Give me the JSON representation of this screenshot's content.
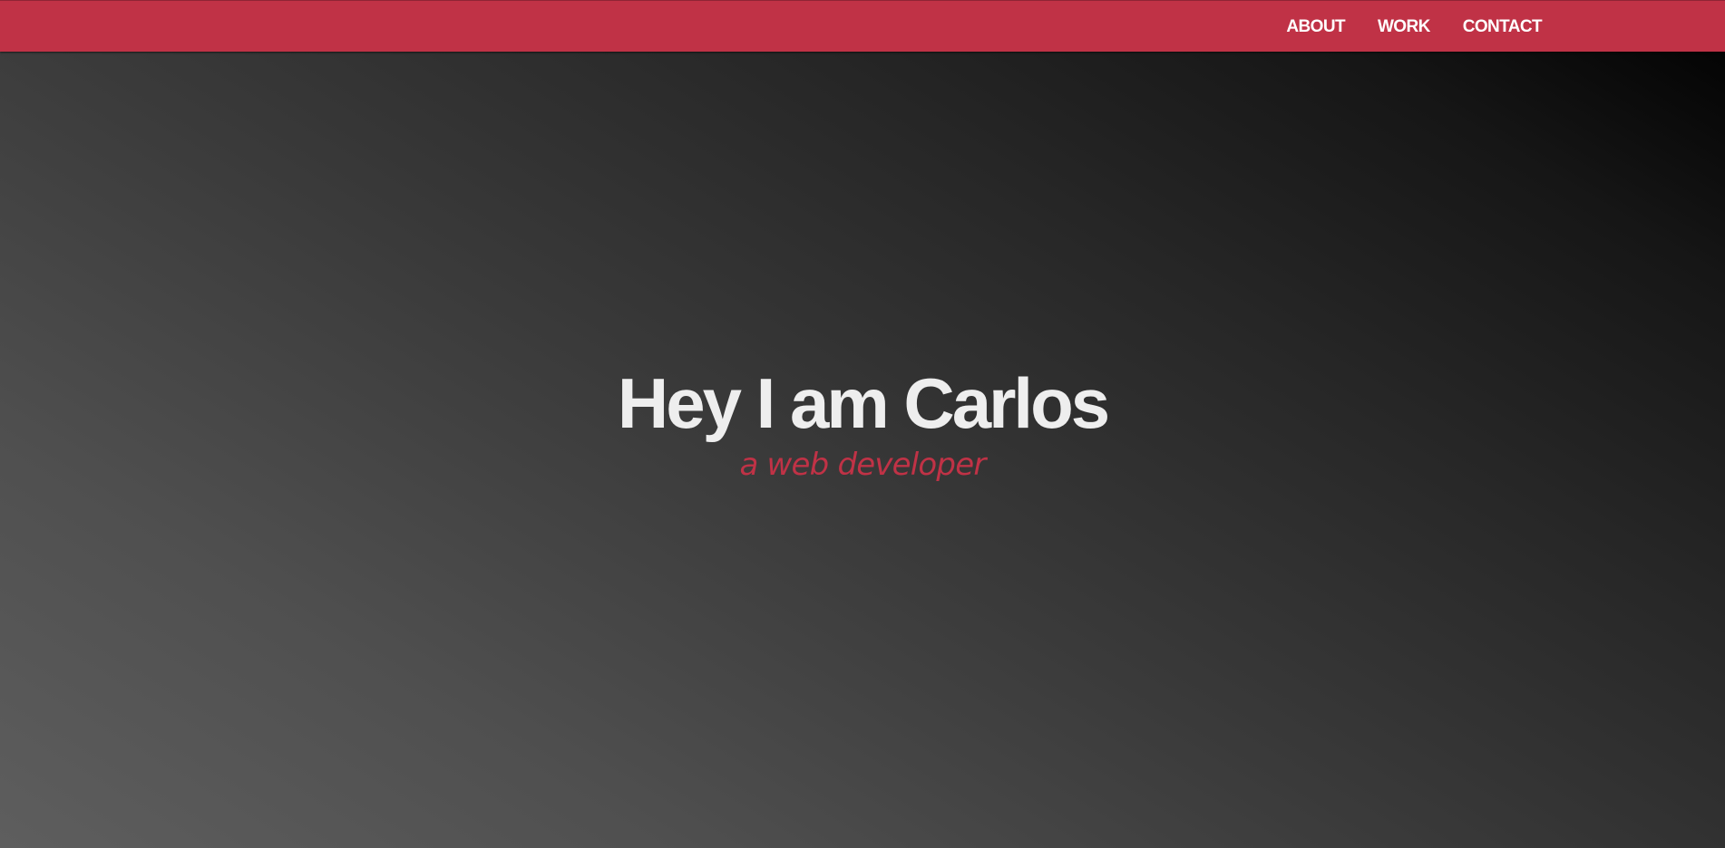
{
  "nav": {
    "links": [
      {
        "label": "ABOUT"
      },
      {
        "label": "WORK"
      },
      {
        "label": "CONTACT"
      }
    ]
  },
  "hero": {
    "title": "Hey I am Carlos",
    "subtitle": "a web developer"
  },
  "colors": {
    "accent": "#c03246",
    "text": "#eeeeee",
    "background_light": "#5e5e5e",
    "background_dark": "#000000"
  }
}
